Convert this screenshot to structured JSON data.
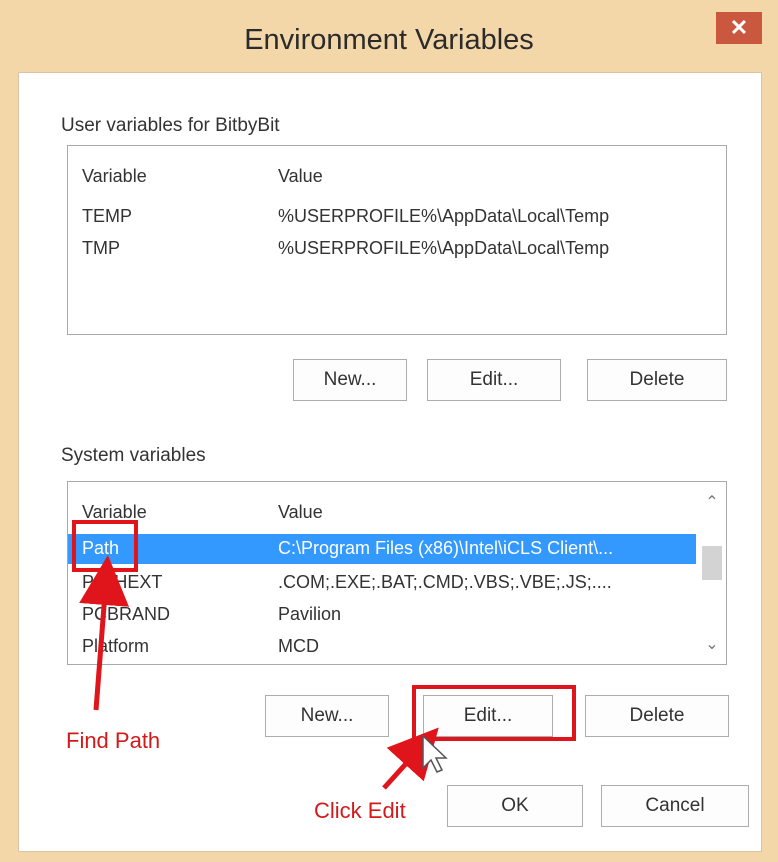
{
  "window": {
    "title": "Environment Variables",
    "close_glyph": "✕"
  },
  "user_section": {
    "label": "User variables for BitbyBit",
    "columns": [
      "Variable",
      "Value"
    ],
    "rows": [
      {
        "variable": "TEMP",
        "value": "%USERPROFILE%\\AppData\\Local\\Temp"
      },
      {
        "variable": "TMP",
        "value": "%USERPROFILE%\\AppData\\Local\\Temp"
      }
    ],
    "buttons": {
      "new": "New...",
      "edit": "Edit...",
      "delete": "Delete"
    }
  },
  "system_section": {
    "label": "System variables",
    "columns": [
      "Variable",
      "Value"
    ],
    "rows": [
      {
        "variable": "Path",
        "value": "C:\\Program Files (x86)\\Intel\\iCLS Client\\...",
        "selected": true
      },
      {
        "variable": "PATHEXT",
        "value": ".COM;.EXE;.BAT;.CMD;.VBS;.VBE;.JS;...."
      },
      {
        "variable": "PCBRAND",
        "value": "Pavilion"
      },
      {
        "variable": "Platform",
        "value": "MCD"
      }
    ],
    "buttons": {
      "new": "New...",
      "edit": "Edit...",
      "delete": "Delete"
    }
  },
  "footer": {
    "ok": "OK",
    "cancel": "Cancel"
  },
  "annotations": {
    "find_path": "Find Path",
    "click_edit": "Click Edit"
  },
  "colors": {
    "selection": "#3399ff",
    "annotation_red": "#e0141b",
    "title_bar": "#f4d7a9",
    "close_button": "#c9583e"
  }
}
